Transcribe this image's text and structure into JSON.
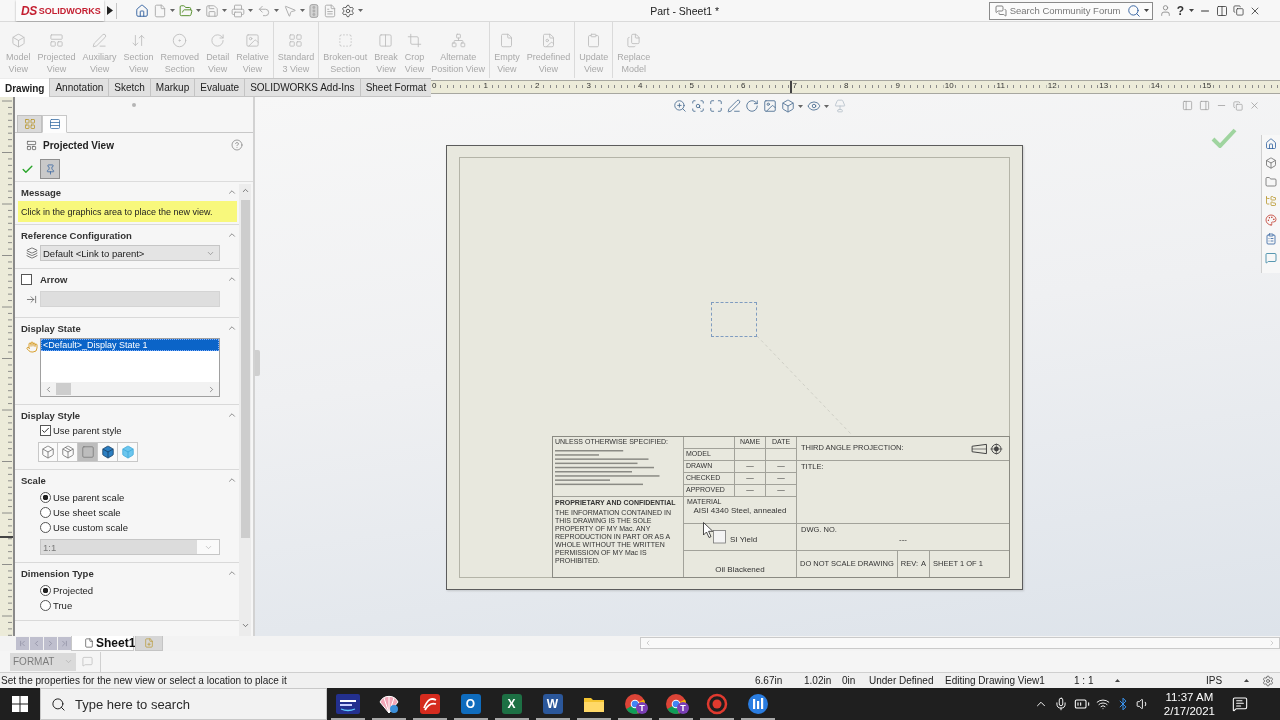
{
  "title_bar": {
    "logo": {
      "mark": "DS",
      "name": "SOLIDWORKS"
    },
    "title": "Part - Sheet1 *",
    "search": {
      "placeholder": "Search Community Forum"
    },
    "help": "?"
  },
  "command_manager": {
    "groups": [
      [
        {
          "kind": "model_view",
          "label": "Model\nView",
          "disabled": true
        },
        {
          "kind": "projected_view",
          "label": "Projected\nView",
          "disabled": true
        },
        {
          "kind": "auxiliary_view",
          "label": "Auxiliary\nView",
          "disabled": true
        },
        {
          "kind": "section_view",
          "label": "Section\nView",
          "disabled": true
        },
        {
          "kind": "removed_section",
          "label": "Removed\nSection",
          "disabled": true
        },
        {
          "kind": "detail_view",
          "label": "Detail\nView",
          "disabled": true
        },
        {
          "kind": "relative_view",
          "label": "Relative\nView",
          "disabled": true
        }
      ],
      [
        {
          "kind": "standard_3_view",
          "label": "Standard\n3 View",
          "disabled": true
        }
      ],
      [
        {
          "kind": "broken_out_section",
          "label": "Broken-out\nSection",
          "disabled": true
        },
        {
          "kind": "break_view",
          "label": "Break\nView",
          "disabled": true
        },
        {
          "kind": "crop_view",
          "label": "Crop\nView",
          "disabled": true
        },
        {
          "kind": "alternate_position_view",
          "label": "Alternate\nPosition View",
          "disabled": true
        }
      ],
      [
        {
          "kind": "empty_view",
          "label": "Empty\nView",
          "disabled": true
        },
        {
          "kind": "predefined_view",
          "label": "Predefined\nView",
          "disabled": true
        }
      ],
      [
        {
          "kind": "update_view",
          "label": "Update\nView",
          "disabled": true
        }
      ],
      [
        {
          "kind": "replace_model",
          "label": "Replace\nModel",
          "disabled": true
        }
      ]
    ]
  },
  "tabs": [
    {
      "label": "Drawing",
      "selected": true
    },
    {
      "label": "Annotation",
      "selected": false
    },
    {
      "label": "Sketch",
      "selected": false
    },
    {
      "label": "Markup",
      "selected": false
    },
    {
      "label": "Evaluate",
      "selected": false
    },
    {
      "label": "SOLIDWORKS Add-Ins",
      "selected": false
    },
    {
      "label": "Sheet Format",
      "selected": false
    }
  ],
  "ruler": {
    "labels": [
      "0",
      "1",
      "2",
      "3",
      "4",
      "5",
      "6",
      "7",
      "8",
      "9",
      "10",
      "11",
      "12",
      "13",
      "14",
      "15"
    ]
  },
  "property_manager": {
    "panel_tabs": [
      {
        "kind": "feature_tree",
        "selected": false
      },
      {
        "kind": "properties",
        "selected": true
      }
    ],
    "title": "Projected View",
    "pinned": true,
    "sections": [
      {
        "kind": "message",
        "heading": "Message",
        "expanded": true,
        "text": "Click in the graphics area to place the new view."
      },
      {
        "kind": "config",
        "heading": "Reference Configuration",
        "expanded": true,
        "value": "Default <Link to parent>"
      },
      {
        "kind": "arrow",
        "heading": "Arrow",
        "expanded": true,
        "checked": false,
        "field_disabled": true
      },
      {
        "kind": "display_state",
        "heading": "Display State",
        "expanded": true,
        "items": [
          {
            "label": "<Default>_Display State 1",
            "selected": true
          }
        ]
      },
      {
        "kind": "display_style",
        "heading": "Display Style",
        "expanded": true,
        "use_parent": {
          "label": "Use parent style",
          "checked": true
        },
        "styles": [
          {
            "kind": "wireframe",
            "selected": false
          },
          {
            "kind": "hidden_visible",
            "selected": false
          },
          {
            "kind": "hidden_removed",
            "selected": true
          },
          {
            "kind": "shaded_edges",
            "selected": false
          },
          {
            "kind": "shaded",
            "selected": false
          }
        ]
      },
      {
        "kind": "options",
        "heading": "Scale",
        "expanded": true,
        "options": [
          {
            "label": "Use parent scale",
            "selected": true
          },
          {
            "label": "Use sheet scale",
            "selected": false
          },
          {
            "label": "Use custom scale",
            "selected": false
          }
        ],
        "select": {
          "value": "1:1",
          "disabled": true
        }
      },
      {
        "kind": "options",
        "heading": "Dimension Type",
        "expanded": true,
        "options": [
          {
            "label": "Projected",
            "selected": true
          },
          {
            "label": "True",
            "selected": false
          }
        ]
      }
    ]
  },
  "sheet": {
    "title_block": {
      "tolerance_heading": "UNLESS OTHERWISE SPECIFIED:",
      "columns": [
        "NAME",
        "DATE"
      ],
      "rows": [
        {
          "label": "MODEL"
        },
        {
          "label": "DRAWN",
          "values": [
            "—",
            "—"
          ]
        },
        {
          "label": "CHECKED",
          "values": [
            "—",
            "—"
          ]
        },
        {
          "label": "APPROVED",
          "values": [
            "—",
            "—"
          ]
        }
      ],
      "projection_label": "THIRD ANGLE PROJECTION:",
      "title_label": "TITLE:",
      "proprietary_heading": "PROPRIETARY AND CONFIDENTIAL",
      "proprietary_text": "THE INFORMATION CONTAINED IN THIS DRAWING IS THE SOLE PROPERTY OF MY Mac. ANY REPRODUCTION IN PART OR AS A WHOLE WITHOUT THE WRITTEN PERMISSION OF MY Mac IS PROHIBITED.",
      "material_label": "MATERIAL",
      "material": "AISI 4340 Steel, annealed",
      "weight": "SI Yield",
      "finish": "Oil Blackened",
      "dwg_no_label": "DWG. NO.",
      "dwg_no": "---",
      "scale_note": "DO NOT SCALE DRAWING",
      "rev_label": "REV:",
      "rev": "A",
      "sheet": "SHEET 1 OF 1"
    }
  },
  "sheet_tabs": [
    {
      "label": "Sheet1",
      "selected": true
    }
  ],
  "format_bar": {
    "value": "FORMAT",
    "disabled": true
  },
  "status_bar": {
    "message": "Set the properties for the new view or select a location to place it",
    "fields": [
      {
        "text": "6.67in",
        "menu": false
      },
      {
        "text": "1.02in",
        "menu": false
      },
      {
        "text": "0in",
        "menu": false
      },
      {
        "text": "Under Defined",
        "menu": false
      },
      {
        "text": "Editing Drawing View1",
        "menu": false
      },
      {
        "text": "1 : 1",
        "menu": true
      },
      {
        "text": "IPS",
        "menu": true
      }
    ]
  },
  "taskbar": {
    "search": {
      "placeholder": "Type here to search"
    },
    "apps": [
      {
        "kind": "music",
        "running": true
      },
      {
        "kind": "shell",
        "running": true
      },
      {
        "kind": "solidworks",
        "running": true
      },
      {
        "kind": "outlook",
        "glyph": "O",
        "running": true
      },
      {
        "kind": "excel",
        "glyph": "X",
        "running": true
      },
      {
        "kind": "word",
        "glyph": "W",
        "running": true
      },
      {
        "kind": "explorer",
        "running": true
      },
      {
        "kind": "chrome",
        "badge": "T",
        "running": true
      },
      {
        "kind": "chrome",
        "badge": "T",
        "running": true
      },
      {
        "kind": "recorder",
        "running": true
      },
      {
        "kind": "app",
        "running": true
      }
    ],
    "time": "11:37 AM",
    "date": "2/17/2021"
  }
}
